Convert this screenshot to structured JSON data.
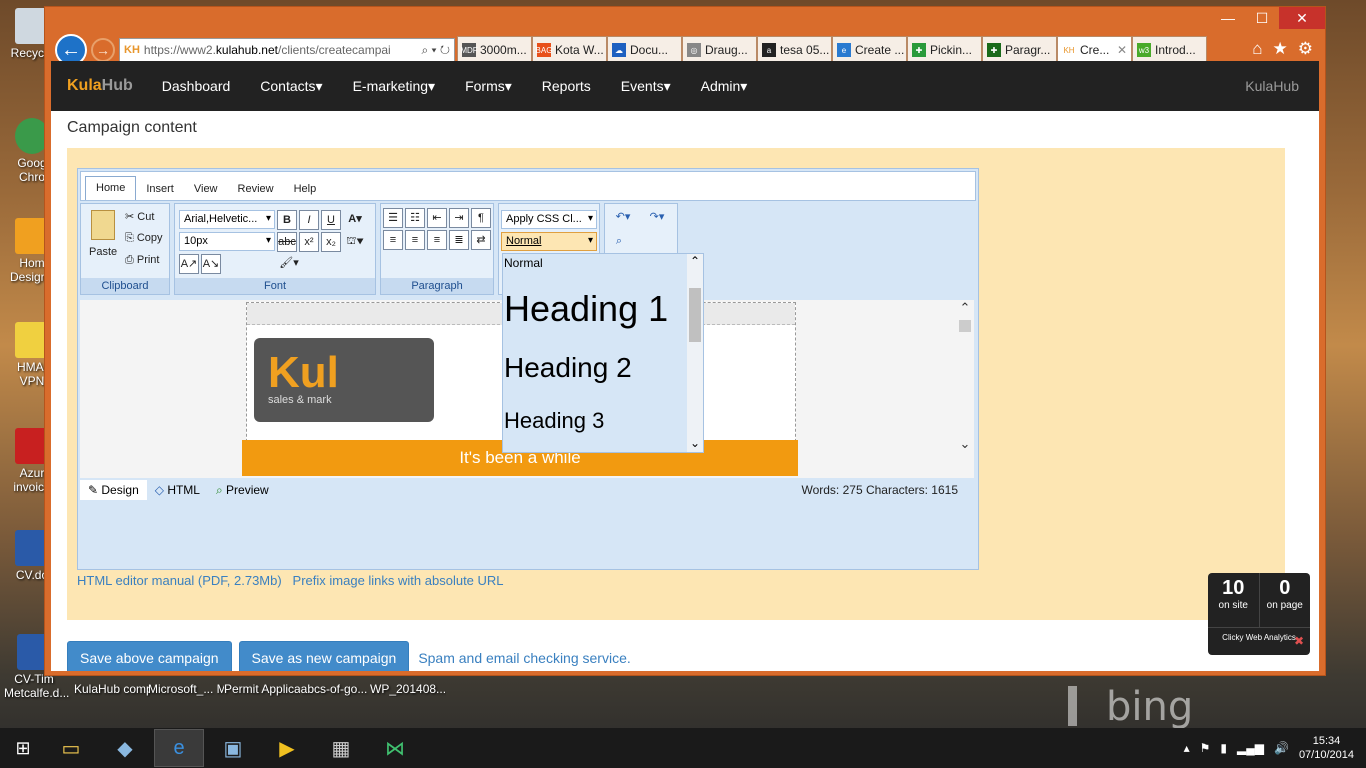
{
  "desktop": {
    "icons": [
      {
        "label": "Recycle",
        "color": "#cfd8e0"
      },
      {
        "label": "Goog Chro",
        "color": "#3a9a4a"
      },
      {
        "label": "Hom Designe",
        "color": "#f0a020"
      },
      {
        "label": "HMA! VPN",
        "color": "#f0d040"
      },
      {
        "label": "Azur invoice",
        "color": "#c82020"
      },
      {
        "label": "CV.do",
        "color": "#2a5aa8"
      },
      {
        "label": "CV-Tim Metcalfe.d...",
        "color": "#2a5aa8"
      }
    ],
    "bottom_icons": [
      "KulaHub companies....",
      "Microsoft_... Microsoft_...",
      "Permit Applicatio...",
      "abcs-of-go...",
      "WP_201408..."
    ],
    "bing": "bing"
  },
  "browser": {
    "address": {
      "prefix": "https://www2.",
      "domain": "kulahub.net",
      "path": "/clients/createcampai",
      "favicon": "KH"
    },
    "tabs": [
      {
        "label": "3000m...",
        "icon": "MDF"
      },
      {
        "label": "Kota W...",
        "icon": "BAG"
      },
      {
        "label": "Docu...",
        "icon": "☁"
      },
      {
        "label": "Draug...",
        "icon": "◎"
      },
      {
        "label": "tesa 05...",
        "icon": "a"
      },
      {
        "label": "Create ...",
        "icon": "e"
      },
      {
        "label": "Pickin...",
        "icon": "✚"
      },
      {
        "label": "Paragr...",
        "icon": "✚"
      },
      {
        "label": "Cre...",
        "icon": "KH",
        "active": true,
        "close": "✕"
      },
      {
        "label": "Introd...",
        "icon": "w3"
      }
    ]
  },
  "app": {
    "brand_a": "Kula",
    "brand_b": "Hub",
    "menu": [
      "Dashboard",
      "Contacts▾",
      "E-marketing▾",
      "Forms▾",
      "Reports",
      "Events▾",
      "Admin▾"
    ],
    "right": "KulaHub",
    "heading": "Campaign content"
  },
  "editor": {
    "ribbon_tabs": [
      "Home",
      "Insert",
      "View",
      "Review",
      "Help"
    ],
    "groups": {
      "clipboard": "Clipboard",
      "font": "Font",
      "paragraph": "Paragraph"
    },
    "clipboard": {
      "paste": "Paste",
      "cut": "Cut",
      "copy": "Copy",
      "print": "Print"
    },
    "font_name": "Arial,Helvetic...",
    "font_size": "10px",
    "css_class": "Apply CSS Cl...",
    "paragraph_style": "Normal",
    "canvas": {
      "strip": "##",
      "logo_big": "Kul",
      "logo_small": "sales & mark",
      "banner": "It's been a while"
    },
    "modes": [
      "Design",
      "HTML",
      "Preview"
    ],
    "stats": "Words: 275    Characters: 1615",
    "dropdown": [
      {
        "label": "Normal",
        "size": 12
      },
      {
        "label": "Heading 1",
        "size": 36
      },
      {
        "label": "Heading 2",
        "size": 28
      },
      {
        "label": "Heading 3",
        "size": 22
      }
    ]
  },
  "links": {
    "manual": "HTML editor manual (PDF, 2.73Mb)",
    "prefix": "Prefix image links with absolute URL"
  },
  "actions": {
    "save": "Save above campaign",
    "save_new": "Save as new campaign",
    "spam": "Spam and email checking service."
  },
  "clicky": {
    "on_site": "10",
    "on_site_label": "on site",
    "on_page": "0",
    "on_page_label": "on page",
    "footer": "Clicky Web Analytics"
  },
  "taskbar": {
    "time": "15:34",
    "date": "07/10/2014"
  }
}
